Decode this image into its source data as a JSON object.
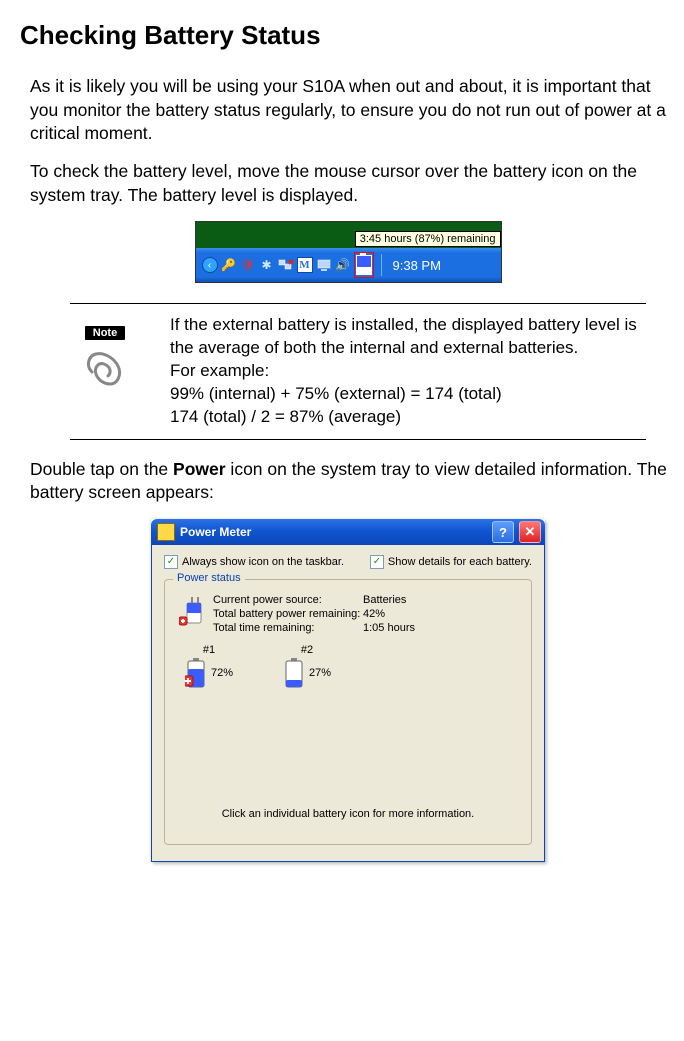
{
  "heading": "Checking Battery Status",
  "para1": "As it is likely you will be using your S10A when out and about, it is important that you monitor the battery status regularly, to ensure you do not run out of power at a critical moment.",
  "para2": "To check the battery level, move the mouse cursor over the battery icon on the system tray. The battery level is displayed.",
  "systray": {
    "tooltip": "3:45 hours (87%) remaining",
    "clock": "9:38 PM"
  },
  "note": {
    "badge": "Note",
    "line1": "If the external battery is installed, the displayed battery level is the average of both the internal and external batteries.",
    "line2": "For example:",
    "line3": "99% (internal) + 75% (external) = 174 (total)",
    "line4": "174 (total) / 2 = 87% (average)"
  },
  "para3a": "Double tap on the ",
  "para3b": "Power",
  "para3c": " icon on the system tray to view detailed information. The battery screen appears:",
  "pm": {
    "title": "Power Meter",
    "check1": "Always show icon on the taskbar.",
    "check2": "Show details for each battery.",
    "legend": "Power status",
    "row1l": "Current power source:",
    "row1v": "Batteries",
    "row2l": "Total battery power remaining:",
    "row2v": "42%",
    "row3l": "Total time remaining:",
    "row3v": "1:05 hours",
    "b1num": "#1",
    "b1pct": "72%",
    "b2num": "#2",
    "b2pct": "27%",
    "hint": "Click an individual battery icon for more information."
  }
}
